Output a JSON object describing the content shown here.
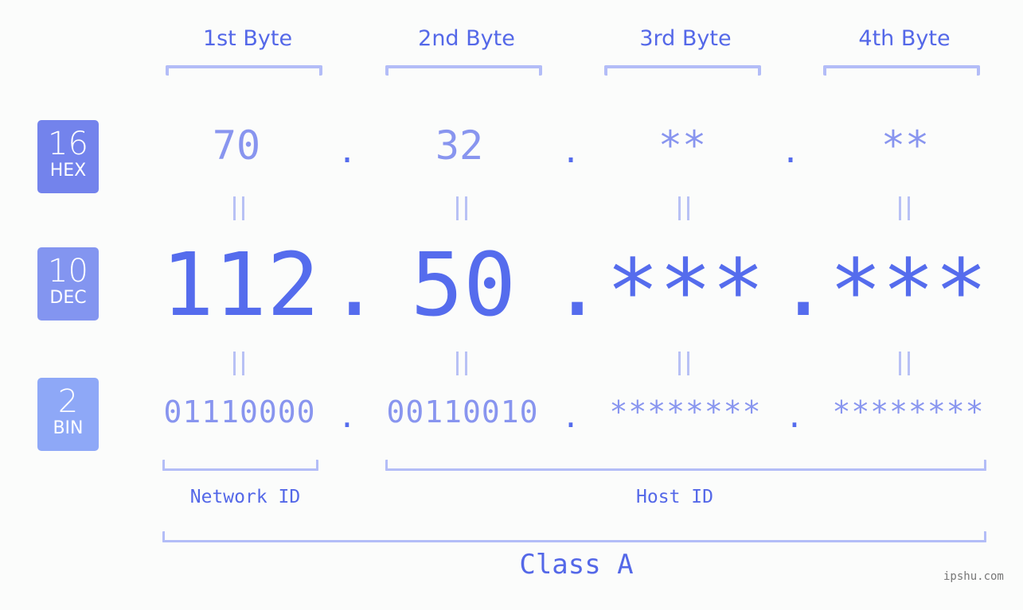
{
  "bytes": {
    "headers": [
      "1st Byte",
      "2nd Byte",
      "3rd Byte",
      "4th Byte"
    ]
  },
  "bases": [
    {
      "num": "16",
      "label": "HEX",
      "color": "#7383ec"
    },
    {
      "num": "10",
      "label": "DEC",
      "color": "#8395f0"
    },
    {
      "num": "2",
      "label": "BIN",
      "color": "#8ea8f7"
    }
  ],
  "hex": [
    "70",
    "32",
    "**",
    "**"
  ],
  "dec": [
    "112",
    "50",
    "***",
    "***"
  ],
  "bin": [
    "01110000",
    "00110010",
    "********",
    "********"
  ],
  "separator": ".",
  "segments": {
    "network": "Network ID",
    "host": "Host ID"
  },
  "class_label": "Class A",
  "watermark": "ipshu.com",
  "colors": {
    "accent": "#556ced",
    "light": "#8895ef",
    "bracket": "#b3bdf7"
  }
}
